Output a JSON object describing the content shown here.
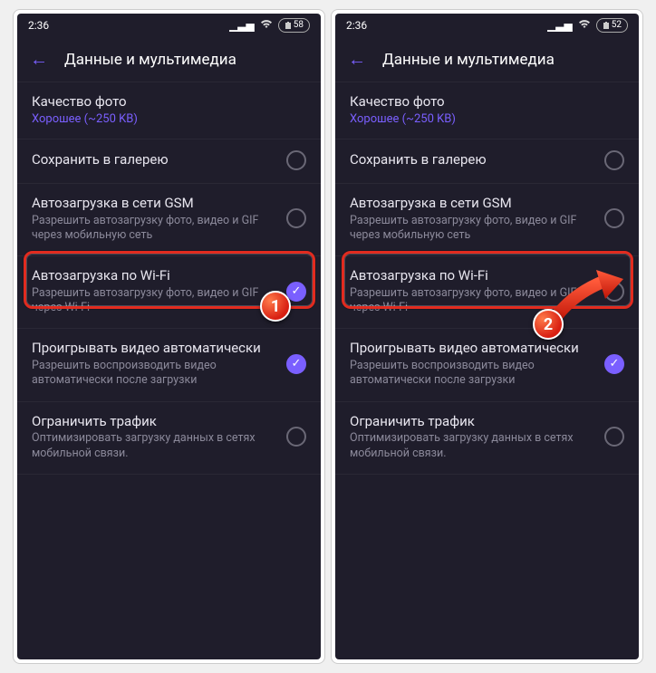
{
  "status": {
    "time": "2:36",
    "battery_left": "58",
    "battery_right": "52"
  },
  "header": {
    "title": "Данные и мультимедиа"
  },
  "items": {
    "quality": {
      "title": "Качество фото",
      "value": "Хорошее (~250 KB)"
    },
    "gallery": {
      "title": "Сохранить в галерею"
    },
    "gsm": {
      "title": "Автозагрузка в сети GSM",
      "sub": "Разрешить автозагрузку фото, видео и GIF через мобильную сеть"
    },
    "wifi": {
      "title": "Автозагрузка по Wi-Fi",
      "sub": "Разрешить автозагрузку фото, видео и GIF через Wi-Fi"
    },
    "autoplay": {
      "title": "Проигрывать видео автоматически",
      "sub": "Разрешить воспроизводить видео автоматически после загрузки"
    },
    "limit": {
      "title": "Ограничить трафик",
      "sub": "Оптимизировать загрузку данных в сетях мобильной связи."
    }
  },
  "badges": {
    "step1": "1",
    "step2": "2"
  }
}
